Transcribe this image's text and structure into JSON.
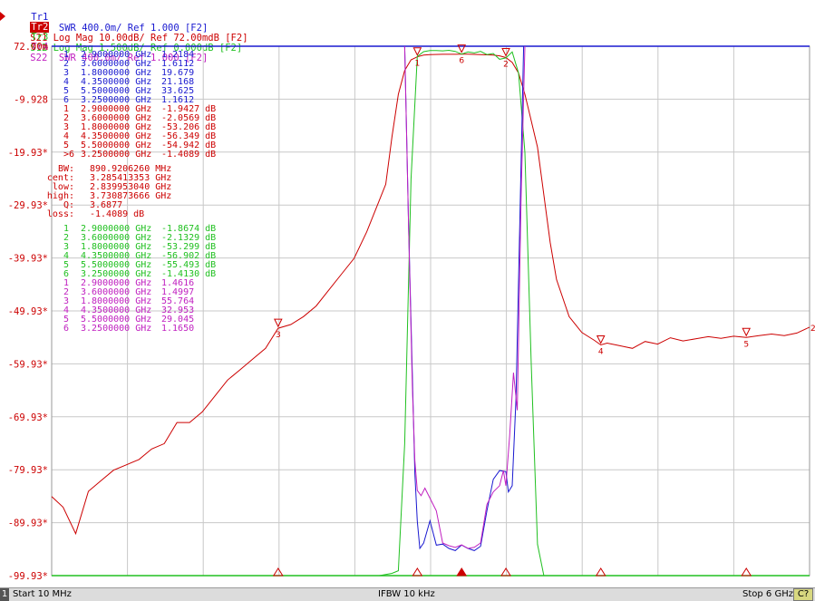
{
  "traces": [
    {
      "tag": "Tr1",
      "text": "S11  SWR 400.0m/ Ref 1.000 [F2]",
      "color": "#1a1ad0",
      "active": false
    },
    {
      "tag": "Tr2",
      "text": "S21 Log Mag 10.00dB/ Ref 72.00mdB [F2]",
      "color": "#cc0000",
      "active": true
    },
    {
      "tag": "Tr3",
      "text": "S12 Log Mag 1.500dB/ Ref 0.000dB [F2]",
      "color": "#20c020",
      "active": false
    },
    {
      "tag": "Tr4",
      "text": "S22  SWR 400.0m/ Ref 1.000 [F2]",
      "color": "#c020c0",
      "active": false
    }
  ],
  "status": {
    "channel_num": "1",
    "start": "Start 10 MHz",
    "ifbw": "IFBW 10 kHz",
    "stop": "Stop 6 GHz",
    "channel_badge": "C?"
  },
  "marker_tables": [
    {
      "color": "#1a1ad0",
      "rows": [
        {
          "n": "1",
          "freq": "2.9000000 GHz",
          "val": "1.2184"
        },
        {
          "n": "2",
          "freq": "3.6000000 GHz",
          "val": "1.6112"
        },
        {
          "n": "3",
          "freq": "1.8000000 GHz",
          "val": "19.679"
        },
        {
          "n": "4",
          "freq": "4.3500000 GHz",
          "val": "21.168"
        },
        {
          "n": "5",
          "freq": "5.5000000 GHz",
          "val": "33.625"
        },
        {
          "n": "6",
          "freq": "3.2500000 GHz",
          "val": "1.1612"
        }
      ]
    },
    {
      "color": "#cc0000",
      "rows": [
        {
          "n": "1",
          "freq": "2.9000000 GHz",
          "val": "-1.9427 dB"
        },
        {
          "n": "2",
          "freq": "3.6000000 GHz",
          "val": "-2.0569 dB"
        },
        {
          "n": "3",
          "freq": "1.8000000 GHz",
          "val": "-53.206 dB"
        },
        {
          "n": "4",
          "freq": "4.3500000 GHz",
          "val": "-56.349 dB"
        },
        {
          "n": "5",
          "freq": "5.5000000 GHz",
          "val": "-54.942 dB"
        },
        {
          "n": ">6",
          "freq": "3.2500000 GHz",
          "val": "-1.4089 dB"
        }
      ]
    },
    {
      "color": "#20c020",
      "rows": [
        {
          "n": "1",
          "freq": "2.9000000 GHz",
          "val": "-1.8674 dB"
        },
        {
          "n": "2",
          "freq": "3.6000000 GHz",
          "val": "-2.1329 dB"
        },
        {
          "n": "3",
          "freq": "1.8000000 GHz",
          "val": "-53.299 dB"
        },
        {
          "n": "4",
          "freq": "4.3500000 GHz",
          "val": "-56.902 dB"
        },
        {
          "n": "5",
          "freq": "5.5000000 GHz",
          "val": "-55.493 dB"
        },
        {
          "n": "6",
          "freq": "3.2500000 GHz",
          "val": "-1.4130 dB"
        }
      ]
    },
    {
      "color": "#c020c0",
      "rows": [
        {
          "n": "1",
          "freq": "2.9000000 GHz",
          "val": "1.4616"
        },
        {
          "n": "2",
          "freq": "3.6000000 GHz",
          "val": "1.4997"
        },
        {
          "n": "3",
          "freq": "1.8000000 GHz",
          "val": "55.764"
        },
        {
          "n": "4",
          "freq": "4.3500000 GHz",
          "val": "32.953"
        },
        {
          "n": "5",
          "freq": "5.5000000 GHz",
          "val": "29.045"
        },
        {
          "n": "6",
          "freq": "3.2500000 GHz",
          "val": "1.1650"
        }
      ]
    }
  ],
  "bandwidth_stats": [
    {
      "label": "BW:",
      "value": "890.9206260 MHz"
    },
    {
      "label": "cent:",
      "value": "3.285413353 GHz"
    },
    {
      "label": "low:",
      "value": "2.839953040 GHz"
    },
    {
      "label": "high:",
      "value": "3.730873666 GHz"
    },
    {
      "label": "Q:",
      "value": "3.6877"
    },
    {
      "label": "loss:",
      "value": "-1.4089 dB"
    }
  ],
  "chart_data": {
    "type": "line",
    "xlim_ghz": [
      0.01,
      6.0
    ],
    "ylim_db": [
      -99.93,
      0.072
    ],
    "y_ticks": [
      "72.00m",
      "-9.928",
      "-19.93*",
      "-29.93*",
      "-39.93*",
      "-49.93*",
      "-59.93*",
      "-69.93*",
      "-79.93*",
      "-89.93*",
      "-99.93*"
    ],
    "grid": true,
    "x_divisions": 10,
    "y_divisions": 10,
    "reference_marker_label": "2",
    "series": [
      {
        "name": "S21",
        "color": "#cc0000",
        "x": [
          0.01,
          0.1,
          0.2,
          0.3,
          0.4,
          0.5,
          0.6,
          0.7,
          0.8,
          0.9,
          1.0,
          1.1,
          1.2,
          1.3,
          1.4,
          1.5,
          1.6,
          1.7,
          1.8,
          1.9,
          2.0,
          2.1,
          2.2,
          2.3,
          2.4,
          2.5,
          2.6,
          2.65,
          2.7,
          2.75,
          2.8,
          2.85,
          2.9,
          2.95,
          3.0,
          3.1,
          3.2,
          3.25,
          3.3,
          3.4,
          3.5,
          3.55,
          3.6,
          3.65,
          3.7,
          3.75,
          3.8,
          3.85,
          3.9,
          3.95,
          4.0,
          4.1,
          4.2,
          4.3,
          4.35,
          4.4,
          4.5,
          4.6,
          4.7,
          4.8,
          4.9,
          5.0,
          5.1,
          5.2,
          5.3,
          5.4,
          5.5,
          5.6,
          5.7,
          5.8,
          5.9,
          6.0
        ],
        "y": [
          -85,
          -87,
          -92,
          -84,
          -82,
          -80,
          -79,
          -78,
          -76,
          -75,
          -71,
          -71,
          -69,
          -66,
          -63,
          -61,
          -59,
          -57,
          -53.2,
          -52.5,
          -51,
          -49,
          -46,
          -43,
          -40,
          -35,
          -29,
          -26,
          -17,
          -9,
          -4.5,
          -2.5,
          -1.94,
          -1.6,
          -1.5,
          -1.45,
          -1.45,
          -1.41,
          -1.42,
          -1.5,
          -1.6,
          -1.75,
          -2.06,
          -3,
          -5,
          -9,
          -14,
          -19,
          -28,
          -37,
          -44,
          -51,
          -54,
          -55.5,
          -56.35,
          -56,
          -56.5,
          -57,
          -55.7,
          -56.2,
          -55,
          -55.6,
          -55.2,
          -54.8,
          -55.1,
          -54.7,
          -54.94,
          -54.6,
          -54.3,
          -54.6,
          -54.1,
          -53
        ]
      },
      {
        "name": "S12",
        "color": "#20c020",
        "x": [
          0.01,
          2.5,
          2.6,
          2.7,
          2.75,
          2.8,
          2.85,
          2.9,
          2.95,
          3.0,
          3.05,
          3.1,
          3.15,
          3.2,
          3.25,
          3.3,
          3.35,
          3.4,
          3.45,
          3.5,
          3.55,
          3.6,
          3.65,
          3.7,
          3.75,
          3.8,
          3.85,
          3.9,
          4.0,
          6.0
        ],
        "y": [
          -99.93,
          -99.93,
          -99.93,
          -99.5,
          -99,
          -75,
          -25,
          -1.87,
          -0.95,
          -0.75,
          -0.75,
          -0.8,
          -0.7,
          -0.9,
          -1.41,
          -1.0,
          -1.2,
          -0.9,
          -1.5,
          -1.3,
          -2.4,
          -2.13,
          -1.0,
          -5,
          -20,
          -60,
          -94,
          -99.93,
          -99.93,
          -99.93
        ]
      },
      {
        "name": "S11",
        "color": "#1a1ad0",
        "x": [
          2.8,
          2.83,
          2.86,
          2.88,
          2.9,
          2.92,
          2.95,
          3.0,
          3.05,
          3.1,
          3.15,
          3.2,
          3.25,
          3.3,
          3.35,
          3.4,
          3.45,
          3.5,
          3.55,
          3.6,
          3.62,
          3.65,
          3.68,
          3.71,
          3.74
        ],
        "y": [
          5,
          3.6,
          2.4,
          1.6,
          1.2184,
          1.1,
          1.2,
          1.22,
          1.16,
          1.18,
          1.1,
          1.06,
          1.1612,
          1.1,
          1.06,
          1.14,
          1.3,
          1.55,
          1.62,
          1.6112,
          1.45,
          1.5,
          2.2,
          3.6,
          5
        ]
      },
      {
        "name": "S22",
        "color": "#c020c0",
        "x": [
          2.8,
          2.83,
          2.86,
          2.88,
          2.9,
          2.93,
          2.96,
          3.0,
          3.05,
          3.1,
          3.15,
          3.2,
          3.25,
          3.3,
          3.35,
          3.4,
          3.45,
          3.5,
          3.55,
          3.58,
          3.6,
          3.63,
          3.66,
          3.69,
          3.72,
          3.75
        ],
        "y": [
          5,
          3.6,
          2.3,
          1.7,
          1.4616,
          1.42,
          1.48,
          1.4,
          1.3,
          1.2,
          1.15,
          1.12,
          1.165,
          1.1,
          1.12,
          1.2,
          1.35,
          1.45,
          1.5,
          1.62,
          1.4997,
          1.9,
          2.4,
          2.1,
          3.8,
          5
        ]
      }
    ],
    "marker_freqs_ghz": [
      2.9,
      3.6,
      1.8,
      4.35,
      5.5,
      3.25
    ]
  }
}
